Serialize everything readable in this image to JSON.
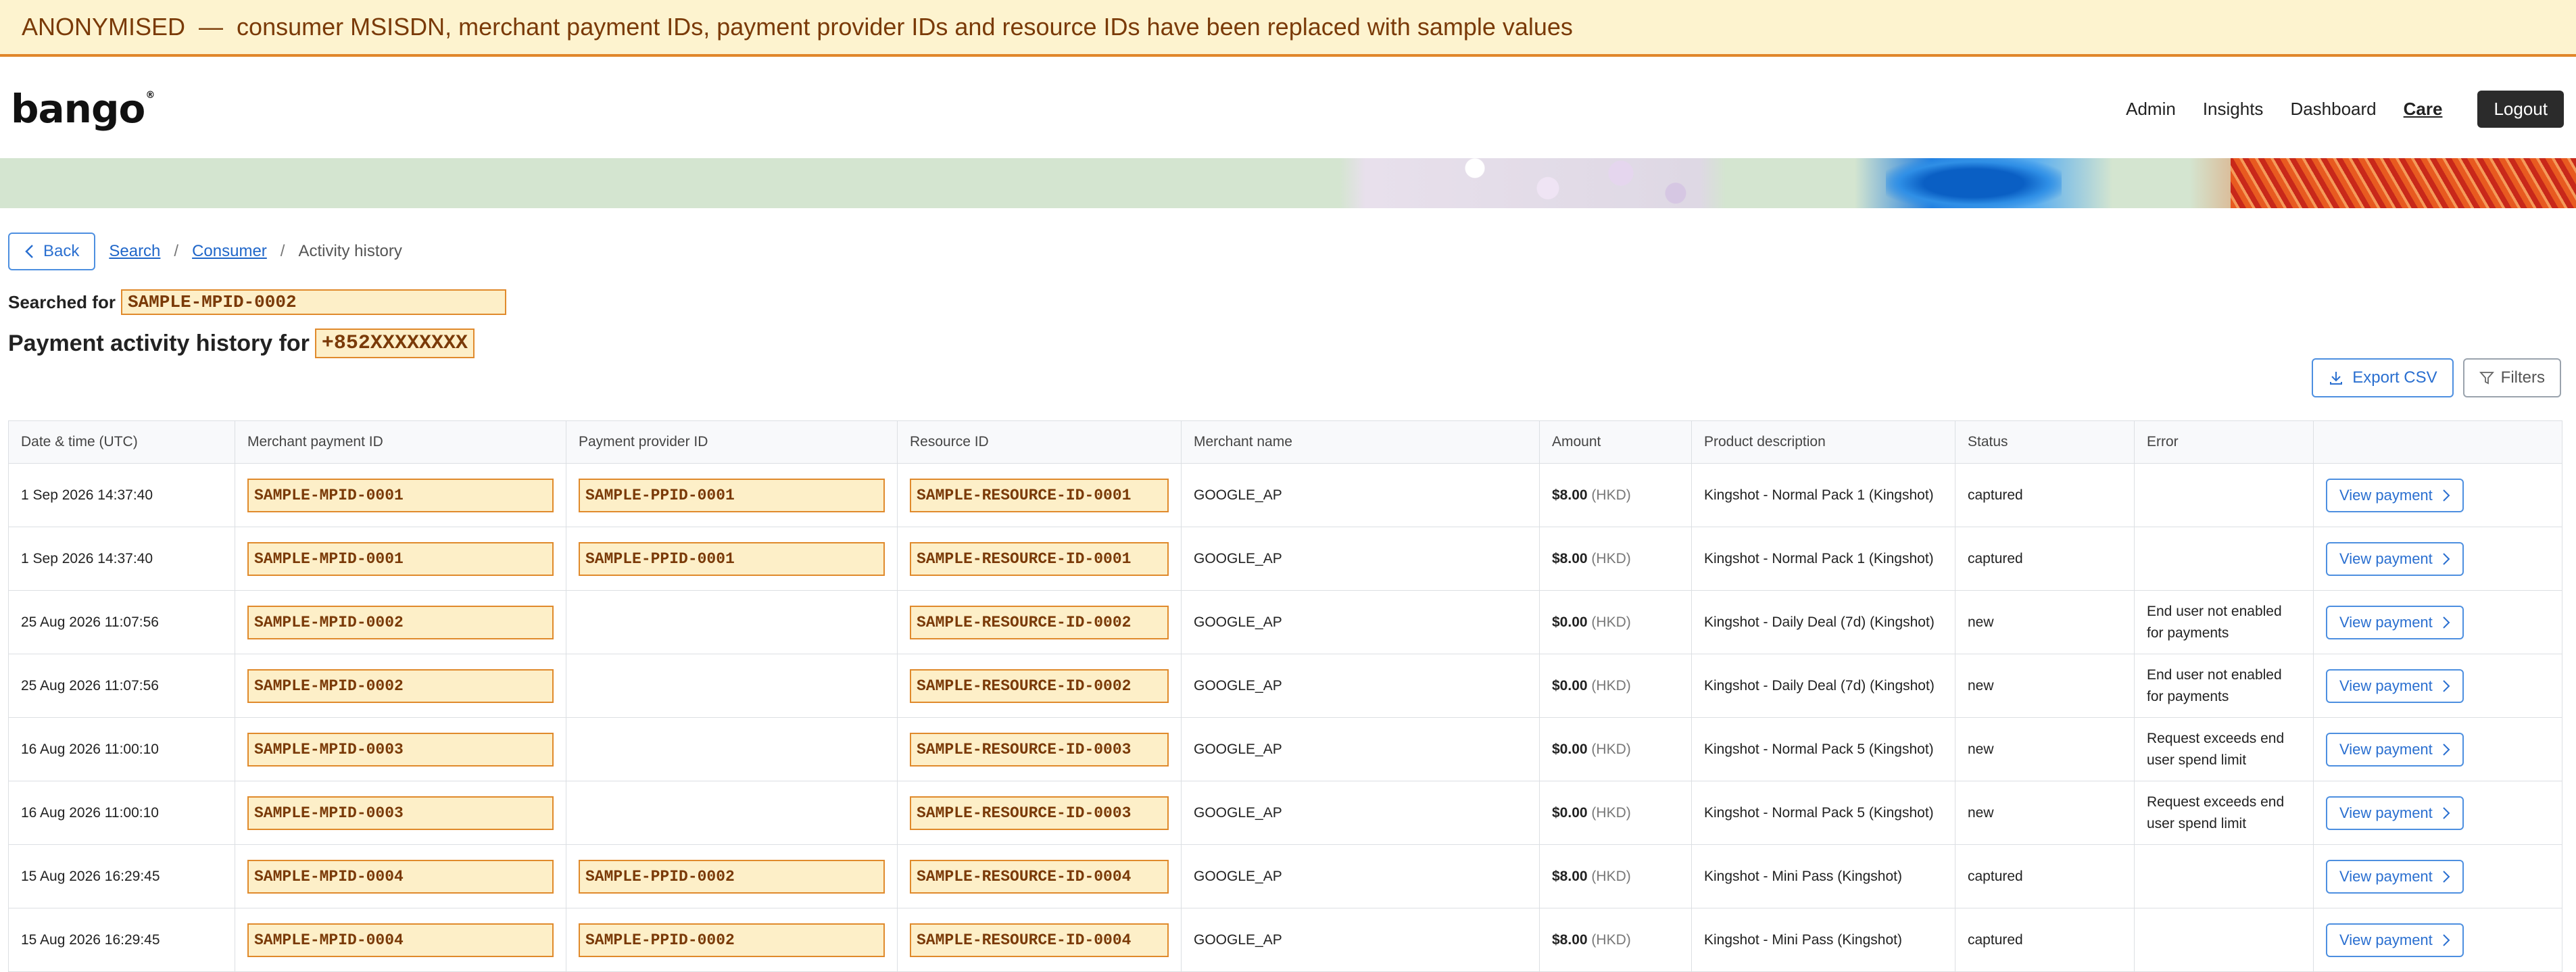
{
  "banner": {
    "text": "ANONYMISED  —  consumer MSISDN, merchant payment IDs, payment provider IDs and resource IDs have been replaced with sample values"
  },
  "header": {
    "logo": "bango",
    "nav": [
      "Admin",
      "Insights",
      "Dashboard",
      "Care"
    ],
    "active_nav": "Care",
    "logout": "Logout"
  },
  "breadcrumb": {
    "back": "Back",
    "items": [
      "Search",
      "Consumer",
      "Activity history"
    ]
  },
  "search": {
    "label": "Searched for",
    "value": "SAMPLE-MPID-0002"
  },
  "page": {
    "title": "Payment activity history for",
    "msisdn": "+852XXXXXXXX"
  },
  "toolbar": {
    "export": "Export CSV",
    "filters": "Filters"
  },
  "table": {
    "columns": [
      "Date & time (UTC)",
      "Merchant payment ID",
      "Payment provider ID",
      "Resource ID",
      "Merchant name",
      "Amount",
      "Product description",
      "Status",
      "Error",
      ""
    ],
    "action_label": "View payment",
    "rows": [
      {
        "date": "1 Sep 2026 14:37:40",
        "mpid": "SAMPLE-MPID-0001",
        "ppid": "SAMPLE-PPID-0001",
        "rid": "SAMPLE-RESOURCE-ID-0001",
        "merchant": "GOOGLE_AP",
        "amount": "$8.00",
        "currency": "(HKD)",
        "product": "Kingshot - Normal Pack 1 (Kingshot)",
        "status": "captured",
        "error": ""
      },
      {
        "date": "1 Sep 2026 14:37:40",
        "mpid": "SAMPLE-MPID-0001",
        "ppid": "SAMPLE-PPID-0001",
        "rid": "SAMPLE-RESOURCE-ID-0001",
        "merchant": "GOOGLE_AP",
        "amount": "$8.00",
        "currency": "(HKD)",
        "product": "Kingshot - Normal Pack 1 (Kingshot)",
        "status": "captured",
        "error": ""
      },
      {
        "date": "25 Aug 2026 11:07:56",
        "mpid": "SAMPLE-MPID-0002",
        "ppid": "",
        "rid": "SAMPLE-RESOURCE-ID-0002",
        "merchant": "GOOGLE_AP",
        "amount": "$0.00",
        "currency": "(HKD)",
        "product": "Kingshot - Daily Deal (7d) (Kingshot)",
        "status": "new",
        "error": "End user not enabled for payments"
      },
      {
        "date": "25 Aug 2026 11:07:56",
        "mpid": "SAMPLE-MPID-0002",
        "ppid": "",
        "rid": "SAMPLE-RESOURCE-ID-0002",
        "merchant": "GOOGLE_AP",
        "amount": "$0.00",
        "currency": "(HKD)",
        "product": "Kingshot - Daily Deal (7d) (Kingshot)",
        "status": "new",
        "error": "End user not enabled for payments"
      },
      {
        "date": "16 Aug 2026 11:00:10",
        "mpid": "SAMPLE-MPID-0003",
        "ppid": "",
        "rid": "SAMPLE-RESOURCE-ID-0003",
        "merchant": "GOOGLE_AP",
        "amount": "$0.00",
        "currency": "(HKD)",
        "product": "Kingshot - Normal Pack 5 (Kingshot)",
        "status": "new",
        "error": "Request exceeds end user spend limit"
      },
      {
        "date": "16 Aug 2026 11:00:10",
        "mpid": "SAMPLE-MPID-0003",
        "ppid": "",
        "rid": "SAMPLE-RESOURCE-ID-0003",
        "merchant": "GOOGLE_AP",
        "amount": "$0.00",
        "currency": "(HKD)",
        "product": "Kingshot - Normal Pack 5 (Kingshot)",
        "status": "new",
        "error": "Request exceeds end user spend limit"
      },
      {
        "date": "15 Aug 2026 16:29:45",
        "mpid": "SAMPLE-MPID-0004",
        "ppid": "SAMPLE-PPID-0002",
        "rid": "SAMPLE-RESOURCE-ID-0004",
        "merchant": "GOOGLE_AP",
        "amount": "$8.00",
        "currency": "(HKD)",
        "product": "Kingshot - Mini Pass (Kingshot)",
        "status": "captured",
        "error": ""
      },
      {
        "date": "15 Aug 2026 16:29:45",
        "mpid": "SAMPLE-MPID-0004",
        "ppid": "SAMPLE-PPID-0002",
        "rid": "SAMPLE-RESOURCE-ID-0004",
        "merchant": "GOOGLE_AP",
        "amount": "$8.00",
        "currency": "(HKD)",
        "product": "Kingshot - Mini Pass (Kingshot)",
        "status": "captured",
        "error": ""
      }
    ]
  },
  "colors": {
    "accent": "#2a6fd0",
    "highlight_fill": "#fdefc8",
    "highlight_border": "#e08a2c",
    "banner_bg": "#fdf3cf"
  },
  "icons": {
    "back": "chevron-left-icon",
    "export": "download-icon",
    "filters": "funnel-icon",
    "row_action": "chevron-right-icon"
  }
}
